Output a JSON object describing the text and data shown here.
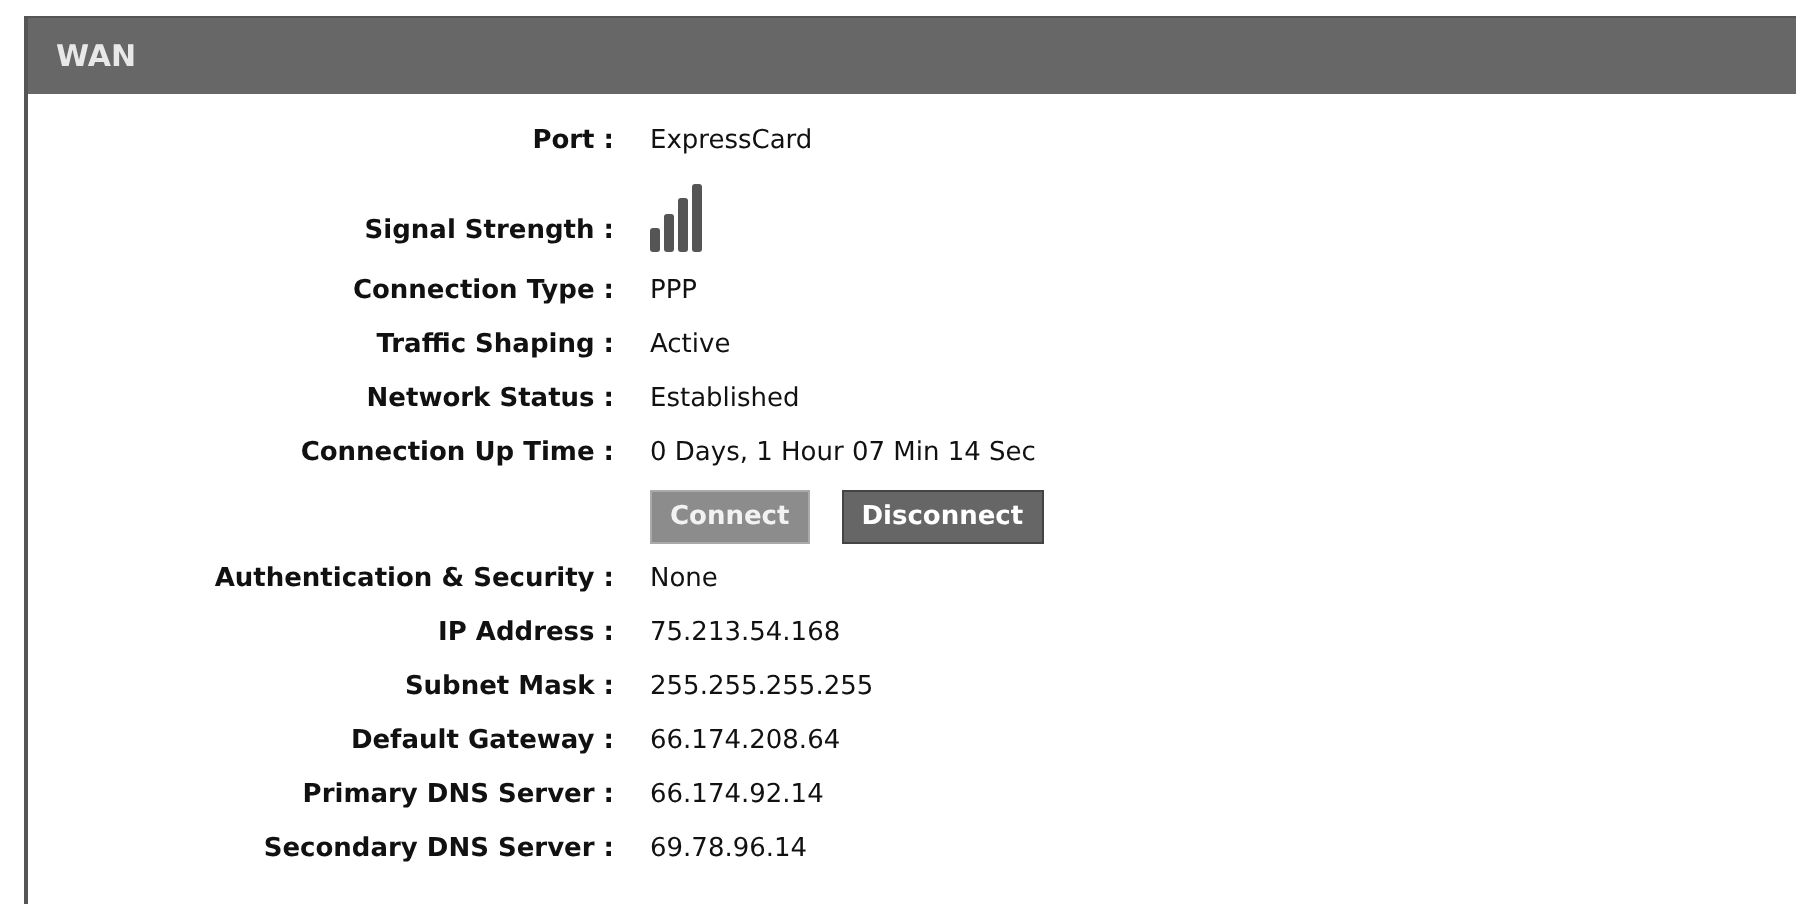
{
  "panel": {
    "title": "WAN"
  },
  "rows": [
    {
      "kind": "text",
      "label": "Port :",
      "value": "ExpressCard"
    },
    {
      "kind": "signal",
      "label": "Signal Strength :"
    },
    {
      "kind": "text",
      "label": "Connection Type :",
      "value": "PPP"
    },
    {
      "kind": "text",
      "label": "Traffic Shaping :",
      "value": "Active"
    },
    {
      "kind": "text",
      "label": "Network Status :",
      "value": "Established"
    },
    {
      "kind": "text",
      "label": "Connection Up Time :",
      "value": "0 Days, 1 Hour 07 Min 14 Sec"
    },
    {
      "kind": "buttons",
      "buttons": [
        {
          "label": "Connect",
          "disabled": true
        },
        {
          "label": "Disconnect",
          "disabled": false
        }
      ]
    },
    {
      "kind": "text",
      "label": "Authentication & Security :",
      "value": "None"
    },
    {
      "kind": "text",
      "label": "IP Address :",
      "value": "75.213.54.168"
    },
    {
      "kind": "text",
      "label": "Subnet Mask :",
      "value": "255.255.255.255"
    },
    {
      "kind": "text",
      "label": "Default Gateway :",
      "value": "66.174.208.64"
    },
    {
      "kind": "text",
      "label": "Primary DNS Server :",
      "value": "66.174.92.14"
    },
    {
      "kind": "text",
      "label": "Secondary DNS Server :",
      "value": "69.78.96.14"
    }
  ]
}
